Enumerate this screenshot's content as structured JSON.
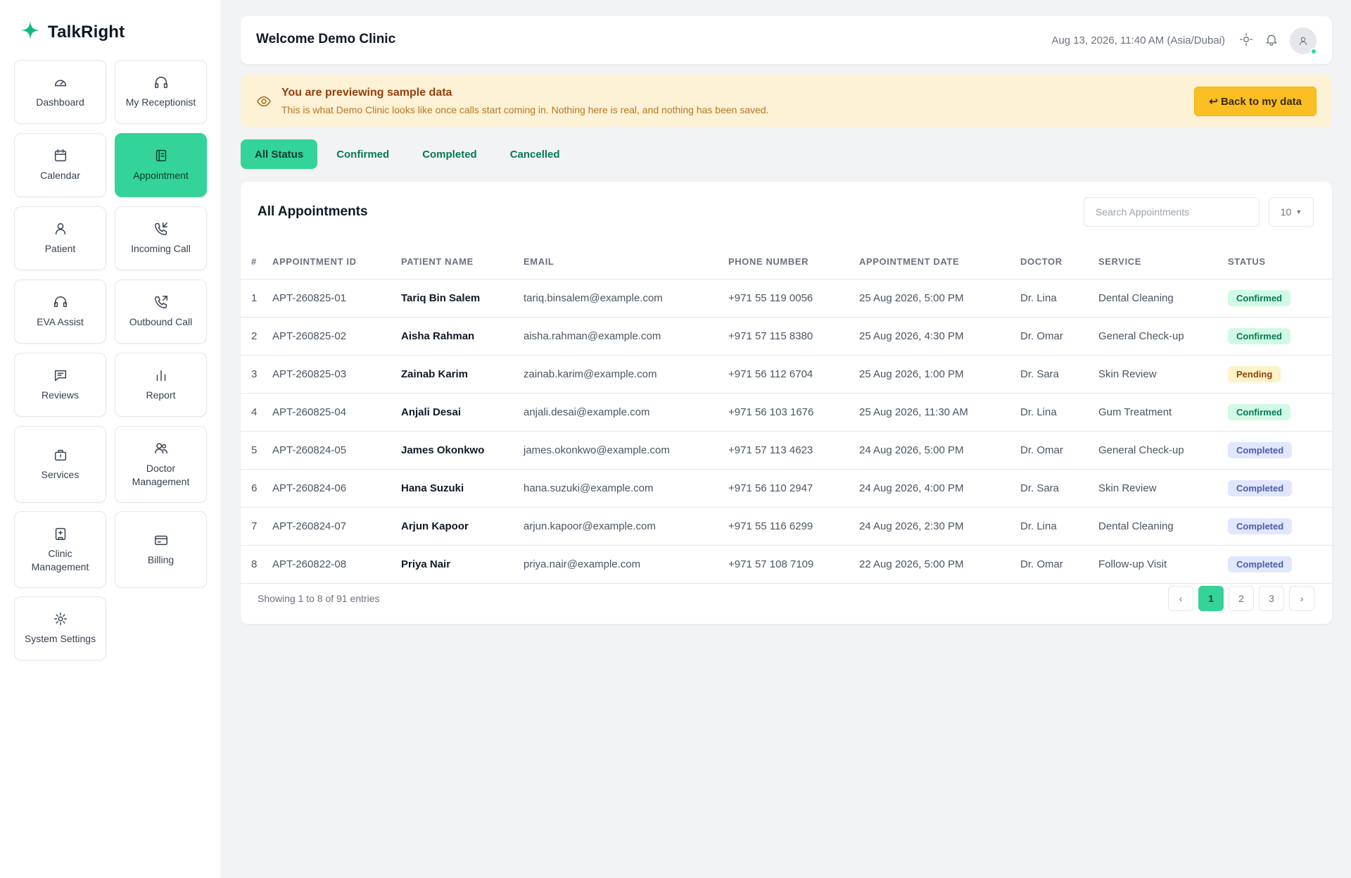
{
  "app": {
    "name": "TalkRight"
  },
  "colors": {
    "accent": "#34d399",
    "banner_bg": "#fdf1d6",
    "banner_button": "#fbbf24"
  },
  "sidebar": {
    "items": [
      {
        "label": "Dashboard",
        "icon": "gauge-icon",
        "active": false
      },
      {
        "label": "My Receptionist",
        "icon": "headphones-icon",
        "active": false
      },
      {
        "label": "Calendar",
        "icon": "calendar-icon",
        "active": false
      },
      {
        "label": "Appointment",
        "icon": "notebook-icon",
        "active": true
      },
      {
        "label": "Patient",
        "icon": "user-icon",
        "active": false
      },
      {
        "label": "Incoming Call",
        "icon": "phone-incoming-icon",
        "active": false
      },
      {
        "label": "EVA Assist",
        "icon": "headset-icon",
        "active": false
      },
      {
        "label": "Outbound Call",
        "icon": "phone-outgoing-icon",
        "active": false
      },
      {
        "label": "Reviews",
        "icon": "message-icon",
        "active": false
      },
      {
        "label": "Report",
        "icon": "bar-chart-icon",
        "active": false
      },
      {
        "label": "Services",
        "icon": "briefcase-icon",
        "active": false
      },
      {
        "label": "Doctor Management",
        "icon": "users-icon",
        "active": false
      },
      {
        "label": "Clinic Management",
        "icon": "clinic-icon",
        "active": false
      },
      {
        "label": "Billing",
        "icon": "credit-card-icon",
        "active": false
      },
      {
        "label": "System Settings",
        "icon": "gear-icon",
        "active": false
      }
    ]
  },
  "header": {
    "welcome": "Welcome Demo Clinic",
    "datetime": "Aug 13, 2026, 11:40 AM (Asia/Dubai)"
  },
  "banner": {
    "title": "You are previewing sample data",
    "subtitle": "This is what Demo Clinic looks like once calls start coming in. Nothing here is real, and nothing has been saved.",
    "button": "↩ Back to my data"
  },
  "tabs": [
    {
      "label": "All Status",
      "active": true
    },
    {
      "label": "Confirmed",
      "active": false
    },
    {
      "label": "Completed",
      "active": false
    },
    {
      "label": "Cancelled",
      "active": false
    }
  ],
  "table": {
    "title": "All Appointments",
    "search_placeholder": "Search Appointments",
    "page_size": "10",
    "columns": [
      "#",
      "APPOINTMENT ID",
      "PATIENT NAME",
      "EMAIL",
      "PHONE NUMBER",
      "APPOINTMENT DATE",
      "DOCTOR",
      "SERVICE",
      "STATUS"
    ],
    "rows": [
      {
        "n": "1",
        "id": "APT-260825-01",
        "name": "Tariq Bin Salem",
        "email": "tariq.binsalem@example.com",
        "phone": "+971 55 119 0056",
        "date": "25 Aug 2026, 5:00 PM",
        "doctor": "Dr. Lina",
        "service": "Dental Cleaning",
        "status": "Confirmed"
      },
      {
        "n": "2",
        "id": "APT-260825-02",
        "name": "Aisha Rahman",
        "email": "aisha.rahman@example.com",
        "phone": "+971 57 115 8380",
        "date": "25 Aug 2026, 4:30 PM",
        "doctor": "Dr. Omar",
        "service": "General Check-up",
        "status": "Confirmed"
      },
      {
        "n": "3",
        "id": "APT-260825-03",
        "name": "Zainab Karim",
        "email": "zainab.karim@example.com",
        "phone": "+971 56 112 6704",
        "date": "25 Aug 2026, 1:00 PM",
        "doctor": "Dr. Sara",
        "service": "Skin Review",
        "status": "Pending"
      },
      {
        "n": "4",
        "id": "APT-260825-04",
        "name": "Anjali Desai",
        "email": "anjali.desai@example.com",
        "phone": "+971 56 103 1676",
        "date": "25 Aug 2026, 11:30 AM",
        "doctor": "Dr. Lina",
        "service": "Gum Treatment",
        "status": "Confirmed"
      },
      {
        "n": "5",
        "id": "APT-260824-05",
        "name": "James Okonkwo",
        "email": "james.okonkwo@example.com",
        "phone": "+971 57 113 4623",
        "date": "24 Aug 2026, 5:00 PM",
        "doctor": "Dr. Omar",
        "service": "General Check-up",
        "status": "Completed"
      },
      {
        "n": "6",
        "id": "APT-260824-06",
        "name": "Hana Suzuki",
        "email": "hana.suzuki@example.com",
        "phone": "+971 56 110 2947",
        "date": "24 Aug 2026, 4:00 PM",
        "doctor": "Dr. Sara",
        "service": "Skin Review",
        "status": "Completed"
      },
      {
        "n": "7",
        "id": "APT-260824-07",
        "name": "Arjun Kapoor",
        "email": "arjun.kapoor@example.com",
        "phone": "+971 55 116 6299",
        "date": "24 Aug 2026, 2:30 PM",
        "doctor": "Dr. Lina",
        "service": "Dental Cleaning",
        "status": "Completed"
      },
      {
        "n": "8",
        "id": "APT-260822-08",
        "name": "Priya Nair",
        "email": "priya.nair@example.com",
        "phone": "+971 57 108 7109",
        "date": "22 Aug 2026, 5:00 PM",
        "doctor": "Dr. Omar",
        "service": "Follow-up Visit",
        "status": "Completed"
      }
    ],
    "showing": "Showing 1 to 8 of 91 entries",
    "pagination": {
      "prev": "‹",
      "pages": [
        "1",
        "2",
        "3"
      ],
      "current": "1",
      "next": "›"
    }
  }
}
